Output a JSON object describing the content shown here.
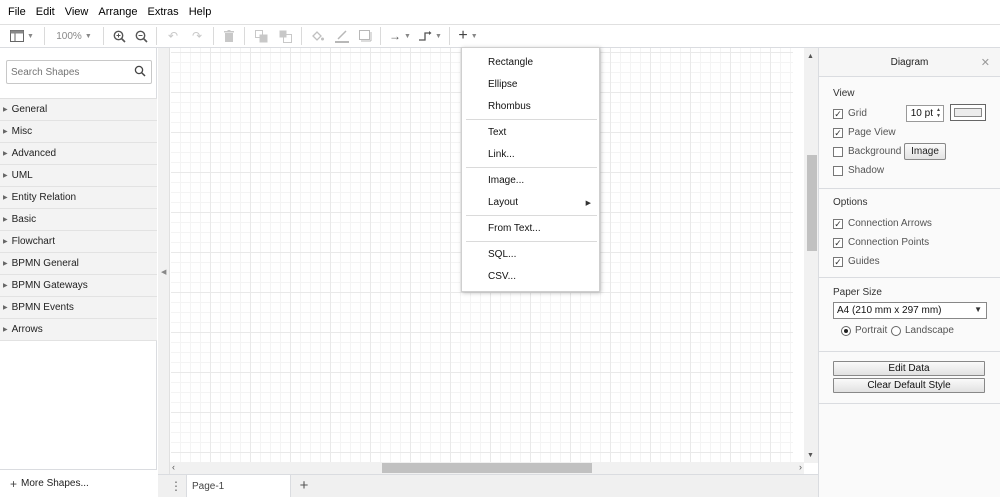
{
  "menubar": {
    "items": [
      "File",
      "Edit",
      "View",
      "Arrange",
      "Extras",
      "Help"
    ]
  },
  "toolbar": {
    "zoom": "100%",
    "icons": [
      "format-panel-icon",
      "zoom-in-icon",
      "zoom-out-icon",
      "undo-icon",
      "redo-icon",
      "delete-icon",
      "to-front-icon",
      "to-back-icon",
      "fill-color-icon",
      "line-color-icon",
      "shadow-icon",
      "connection-icon",
      "waypoints-icon",
      "insert-icon"
    ]
  },
  "sidebar": {
    "search_placeholder": "Search Shapes",
    "categories": [
      "General",
      "Misc",
      "Advanced",
      "UML",
      "Entity Relation",
      "Basic",
      "Flowchart",
      "BPMN General",
      "BPMN Gateways",
      "BPMN Events",
      "Arrows"
    ],
    "more_shapes": "More Shapes..."
  },
  "insert_menu": {
    "items": [
      "Rectangle",
      "Ellipse",
      "Rhombus",
      "Text",
      "Link...",
      "Image...",
      "Layout",
      "From Text...",
      "SQL...",
      "CSV..."
    ]
  },
  "pages": {
    "tab": "Page-1"
  },
  "format_panel": {
    "title": "Diagram",
    "view": {
      "title": "View",
      "grid": "Grid",
      "grid_size": "10 pt",
      "page_view": "Page View",
      "background": "Background",
      "image_button": "Image",
      "shadow": "Shadow"
    },
    "options": {
      "title": "Options",
      "connection_arrows": "Connection Arrows",
      "connection_points": "Connection Points",
      "guides": "Guides"
    },
    "paper": {
      "title": "Paper Size",
      "size": "A4 (210 mm x 297 mm)",
      "portrait": "Portrait",
      "landscape": "Landscape"
    },
    "edit_data": "Edit Data",
    "clear_style": "Clear Default Style"
  },
  "colors": {
    "panel_bg": "#fafafa",
    "sidebar_bg": "#f3f3f3",
    "grid_line": "#e9e9e9"
  }
}
